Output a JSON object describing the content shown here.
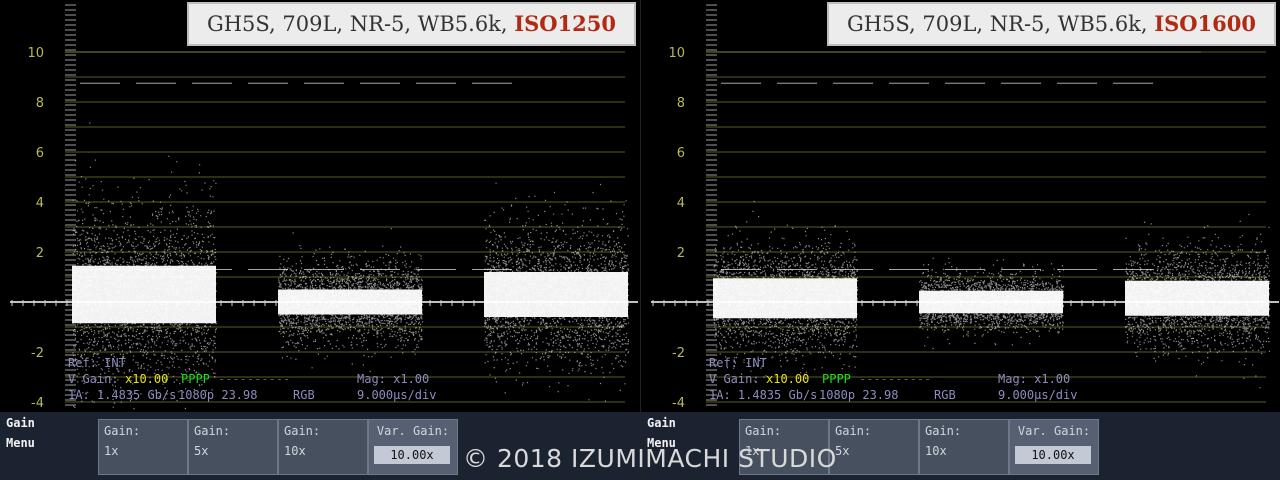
{
  "panels": [
    {
      "title_prefix": "GH5S, 709L, NR-5, WB5.6k,",
      "title_iso": "ISO1250",
      "y_ticks": [
        "10",
        "8",
        "6",
        "4",
        "2",
        "-2",
        "-4"
      ],
      "status": {
        "ref": "Ref: INT",
        "vgain_label": "V Gain:",
        "vgain_value": "x10.00",
        "pppp": "PPPP",
        "dashes": "----------",
        "mag": "Mag:  x1.00",
        "rate": "1A: 1.4835 Gb/s",
        "format": "1080p 23.98",
        "color_space": "RGB",
        "sweep": "9.000μs/div"
      },
      "menu": {
        "title": [
          "Gain",
          "Menu"
        ],
        "buttons": [
          {
            "label": "Gain:",
            "value": "1x"
          },
          {
            "label": "Gain:",
            "value": "5x"
          },
          {
            "label": "Gain:",
            "value": "10x"
          }
        ],
        "var_gain": {
          "label": "Var. Gain:",
          "value": "10.00x"
        }
      },
      "traces": [
        {
          "channel": "R",
          "peak_spread": 4.6,
          "core_spread": 1.15,
          "offset": 0.3
        },
        {
          "channel": "G",
          "peak_spread": 2.1,
          "core_spread": 0.5,
          "offset": 0.0
        },
        {
          "channel": "B",
          "peak_spread": 3.6,
          "core_spread": 0.9,
          "offset": 0.3
        }
      ]
    },
    {
      "title_prefix": "GH5S, 709L, NR-5, WB5.6k,",
      "title_iso": "ISO1600",
      "y_ticks": [
        "10",
        "8",
        "6",
        "4",
        "2",
        "-2",
        "-4"
      ],
      "status": {
        "ref": "Ref: INT",
        "vgain_label": "V Gain:",
        "vgain_value": "x10.00",
        "pppp": "PPPP",
        "dashes": "----------",
        "mag": "Mag:  x1.00",
        "rate": "1A: 1.4835 Gb/s",
        "format": "1080p 23.98",
        "color_space": "RGB",
        "sweep": "9.000μs/div"
      },
      "menu": {
        "title": [
          "Gain",
          "Menu"
        ],
        "buttons": [
          {
            "label": "Gain:",
            "value": "1x"
          },
          {
            "label": "Gain:",
            "value": "5x"
          },
          {
            "label": "Gain:",
            "value": "10x"
          }
        ],
        "var_gain": {
          "label": "Var. Gain:",
          "value": "10.00x"
        }
      },
      "traces": [
        {
          "channel": "R",
          "peak_spread": 2.8,
          "core_spread": 0.8,
          "offset": 0.15
        },
        {
          "channel": "G",
          "peak_spread": 1.4,
          "core_spread": 0.45,
          "offset": 0.0
        },
        {
          "channel": "B",
          "peak_spread": 2.5,
          "core_spread": 0.7,
          "offset": 0.15
        }
      ]
    }
  ],
  "watermark": "© 2018 IZUMIMACHI STUDIO",
  "colors": {
    "graticule": "#a8a83c",
    "trace": "#ffffff",
    "tick_label": "#b8b85a",
    "iso_highlight": "#b22a12"
  }
}
